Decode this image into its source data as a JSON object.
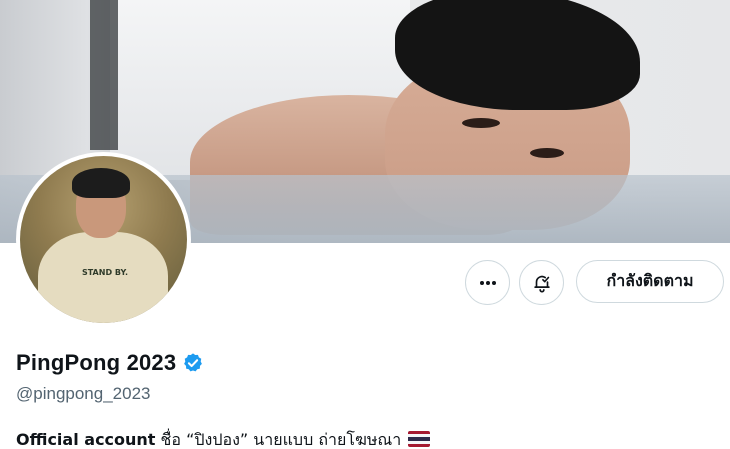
{
  "profile": {
    "display_name": "PingPong 2023",
    "handle": "@pingpong_2023",
    "verified": true,
    "verified_badge_color": "#1d9bf0",
    "bio_bold": "Official account",
    "bio_text": " ชื่อ “ปิงปอง”  นายแบบ ถ่ายโฆษณา",
    "bio_emoji": "thailand-flag",
    "avatar_shirt_text": "STAND BY."
  },
  "actions": {
    "more_icon": "more-horizontal-icon",
    "notify_icon": "bell-check-icon",
    "follow_label": "กำลังติดตาม"
  },
  "colors": {
    "text_primary": "#0f1419",
    "text_secondary": "#536471",
    "border": "#cfd9de"
  }
}
